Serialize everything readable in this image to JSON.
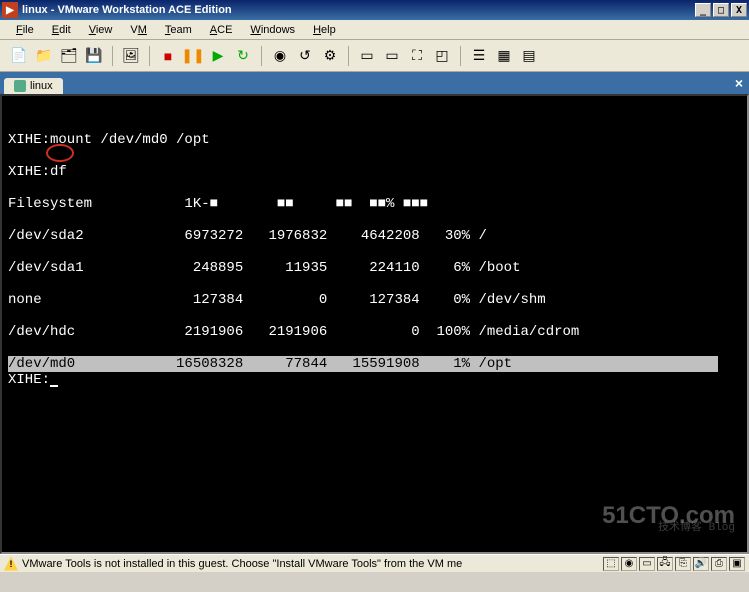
{
  "window": {
    "title": "linux - VMware Workstation ACE Edition"
  },
  "menu": {
    "file": "File",
    "edit": "Edit",
    "view": "View",
    "vm": "VM",
    "team": "Team",
    "ace": "ACE",
    "windows": "Windows",
    "help": "Help"
  },
  "tab": {
    "label": "linux"
  },
  "terminal": {
    "line1": "XIHE:mount /dev/md0 /opt",
    "line2": "XIHE:df",
    "header": "Filesystem           1K-■       ■■     ■■  ■■% ■■■",
    "rows": [
      {
        "fs": "/dev/sda2",
        "blocks": "6973272",
        "used": "1976832",
        "avail": "4642208",
        "pct": "30%",
        "mount": "/"
      },
      {
        "fs": "/dev/sda1",
        "blocks": "248895",
        "used": "11935",
        "avail": "224110",
        "pct": "6%",
        "mount": "/boot"
      },
      {
        "fs": "none",
        "blocks": "127384",
        "used": "0",
        "avail": "127384",
        "pct": "0%",
        "mount": "/dev/shm"
      },
      {
        "fs": "/dev/hdc",
        "blocks": "2191906",
        "used": "2191906",
        "avail": "0",
        "pct": "100%",
        "mount": "/media/cdrom"
      },
      {
        "fs": "/dev/md0",
        "blocks": "16508328",
        "used": "77844",
        "avail": "15591908",
        "pct": "1%",
        "mount": "/opt"
      }
    ],
    "prompt": "XIHE:"
  },
  "status": {
    "text": "VMware Tools is not installed in this guest. Choose \"Install VMware Tools\" from the VM me"
  },
  "watermark": {
    "main": "51CTO.com",
    "sub": "技术博客 Blog"
  }
}
